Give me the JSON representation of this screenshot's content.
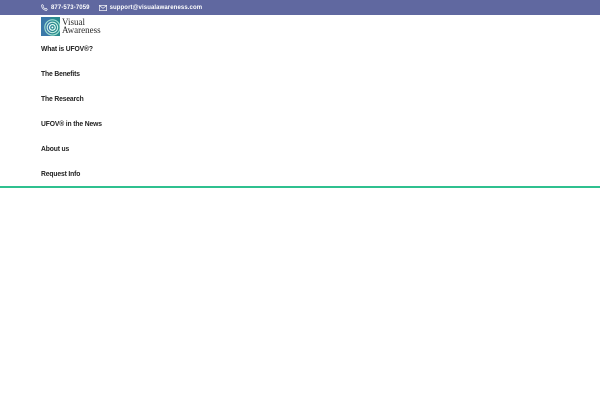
{
  "topbar": {
    "phone": "877-573-7059",
    "email": "support@visualawareness.com",
    "phone_icon": "phone-icon",
    "email_icon": "envelope-icon",
    "color": "#6068a0"
  },
  "logo": {
    "line1": "Visual",
    "line2": "Awareness"
  },
  "nav": {
    "items": [
      "What is UFOV®?",
      "The Benefits",
      "The Research",
      "UFOV® in the News",
      "About us",
      "Request Info"
    ]
  },
  "accent": "#2fc08f"
}
